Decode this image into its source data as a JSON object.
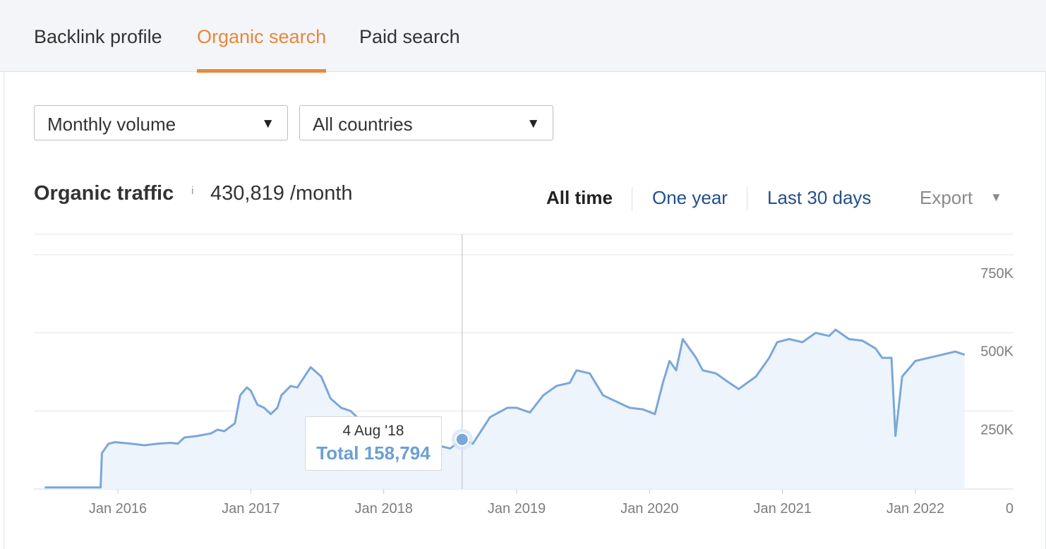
{
  "tabs": [
    {
      "label": "Backlink profile",
      "active": false
    },
    {
      "label": "Organic search",
      "active": true
    },
    {
      "label": "Paid search",
      "active": false
    }
  ],
  "filters": {
    "volume": {
      "value": "Monthly volume"
    },
    "country": {
      "value": "All countries"
    }
  },
  "header": {
    "title": "Organic traffic",
    "info": "i",
    "value": "430,819 /month"
  },
  "ranges": [
    "All time",
    "One year",
    "Last 30 days"
  ],
  "export_label": "Export",
  "colors": {
    "accent": "#e7883a",
    "line": "#7ba7d9",
    "fill": "#eef4fc",
    "link": "#23508a"
  },
  "tooltip": {
    "date": "4 Aug '18",
    "total": "Total 158,794",
    "x": 2018.59,
    "y": 158794
  },
  "chart_data": {
    "type": "area",
    "x_tick_labels": [
      "Jan 2016",
      "Jan 2017",
      "Jan 2018",
      "Jan 2019",
      "Jan 2020",
      "Jan 2021",
      "Jan 2022"
    ],
    "x_ticks": [
      2016,
      2017,
      2018,
      2019,
      2020,
      2021,
      2022
    ],
    "y_tick_labels": [
      "0",
      "250K",
      "500K",
      "750K"
    ],
    "y_ticks": [
      0,
      250000,
      500000,
      750000
    ],
    "ylim": [
      0,
      750000
    ],
    "xlim": [
      2015.45,
      2022.37
    ],
    "grid": true,
    "series": [
      {
        "x": [
          2015.45,
          2015.87,
          2015.88,
          2015.93,
          2015.98,
          2016.1,
          2016.2,
          2016.3,
          2016.4,
          2016.45,
          2016.5,
          2016.6,
          2016.7,
          2016.75,
          2016.8,
          2016.88,
          2016.92,
          2016.97,
          2017.0,
          2017.05,
          2017.1,
          2017.15,
          2017.2,
          2017.23,
          2017.3,
          2017.35,
          2017.45,
          2017.53,
          2017.58,
          2017.6,
          2017.68,
          2017.75,
          2017.8,
          2017.83,
          2017.86,
          2017.95,
          2018.0,
          2018.1,
          2018.2,
          2018.3,
          2018.4,
          2018.5,
          2018.59,
          2018.67,
          2018.8,
          2018.93,
          2019.0,
          2019.1,
          2019.2,
          2019.3,
          2019.4,
          2019.45,
          2019.55,
          2019.65,
          2019.75,
          2019.85,
          2019.95,
          2020.04,
          2020.1,
          2020.15,
          2020.2,
          2020.25,
          2020.35,
          2020.4,
          2020.5,
          2020.6,
          2020.67,
          2020.8,
          2020.9,
          2020.96,
          2021.05,
          2021.15,
          2021.25,
          2021.35,
          2021.4,
          2021.5,
          2021.6,
          2021.7,
          2021.75,
          2021.82,
          2021.85,
          2021.9,
          2022.0,
          2022.1,
          2022.2,
          2022.3,
          2022.37
        ],
        "y": [
          5000,
          5000,
          115000,
          145000,
          150000,
          145000,
          140000,
          145000,
          148000,
          145000,
          165000,
          170000,
          178000,
          190000,
          185000,
          210000,
          300000,
          325000,
          315000,
          270000,
          260000,
          240000,
          260000,
          300000,
          330000,
          325000,
          390000,
          360000,
          310000,
          290000,
          260000,
          250000,
          230000,
          200000,
          180000,
          175000,
          180000,
          170000,
          150000,
          160000,
          140000,
          130000,
          158794,
          145000,
          230000,
          260000,
          260000,
          245000,
          300000,
          330000,
          340000,
          380000,
          370000,
          300000,
          280000,
          260000,
          255000,
          240000,
          340000,
          410000,
          380000,
          480000,
          420000,
          380000,
          370000,
          340000,
          320000,
          360000,
          420000,
          470000,
          480000,
          470000,
          500000,
          490000,
          510000,
          480000,
          475000,
          450000,
          420000,
          420000,
          170000,
          360000,
          410000,
          420000,
          430000,
          440000,
          430000
        ]
      }
    ]
  }
}
